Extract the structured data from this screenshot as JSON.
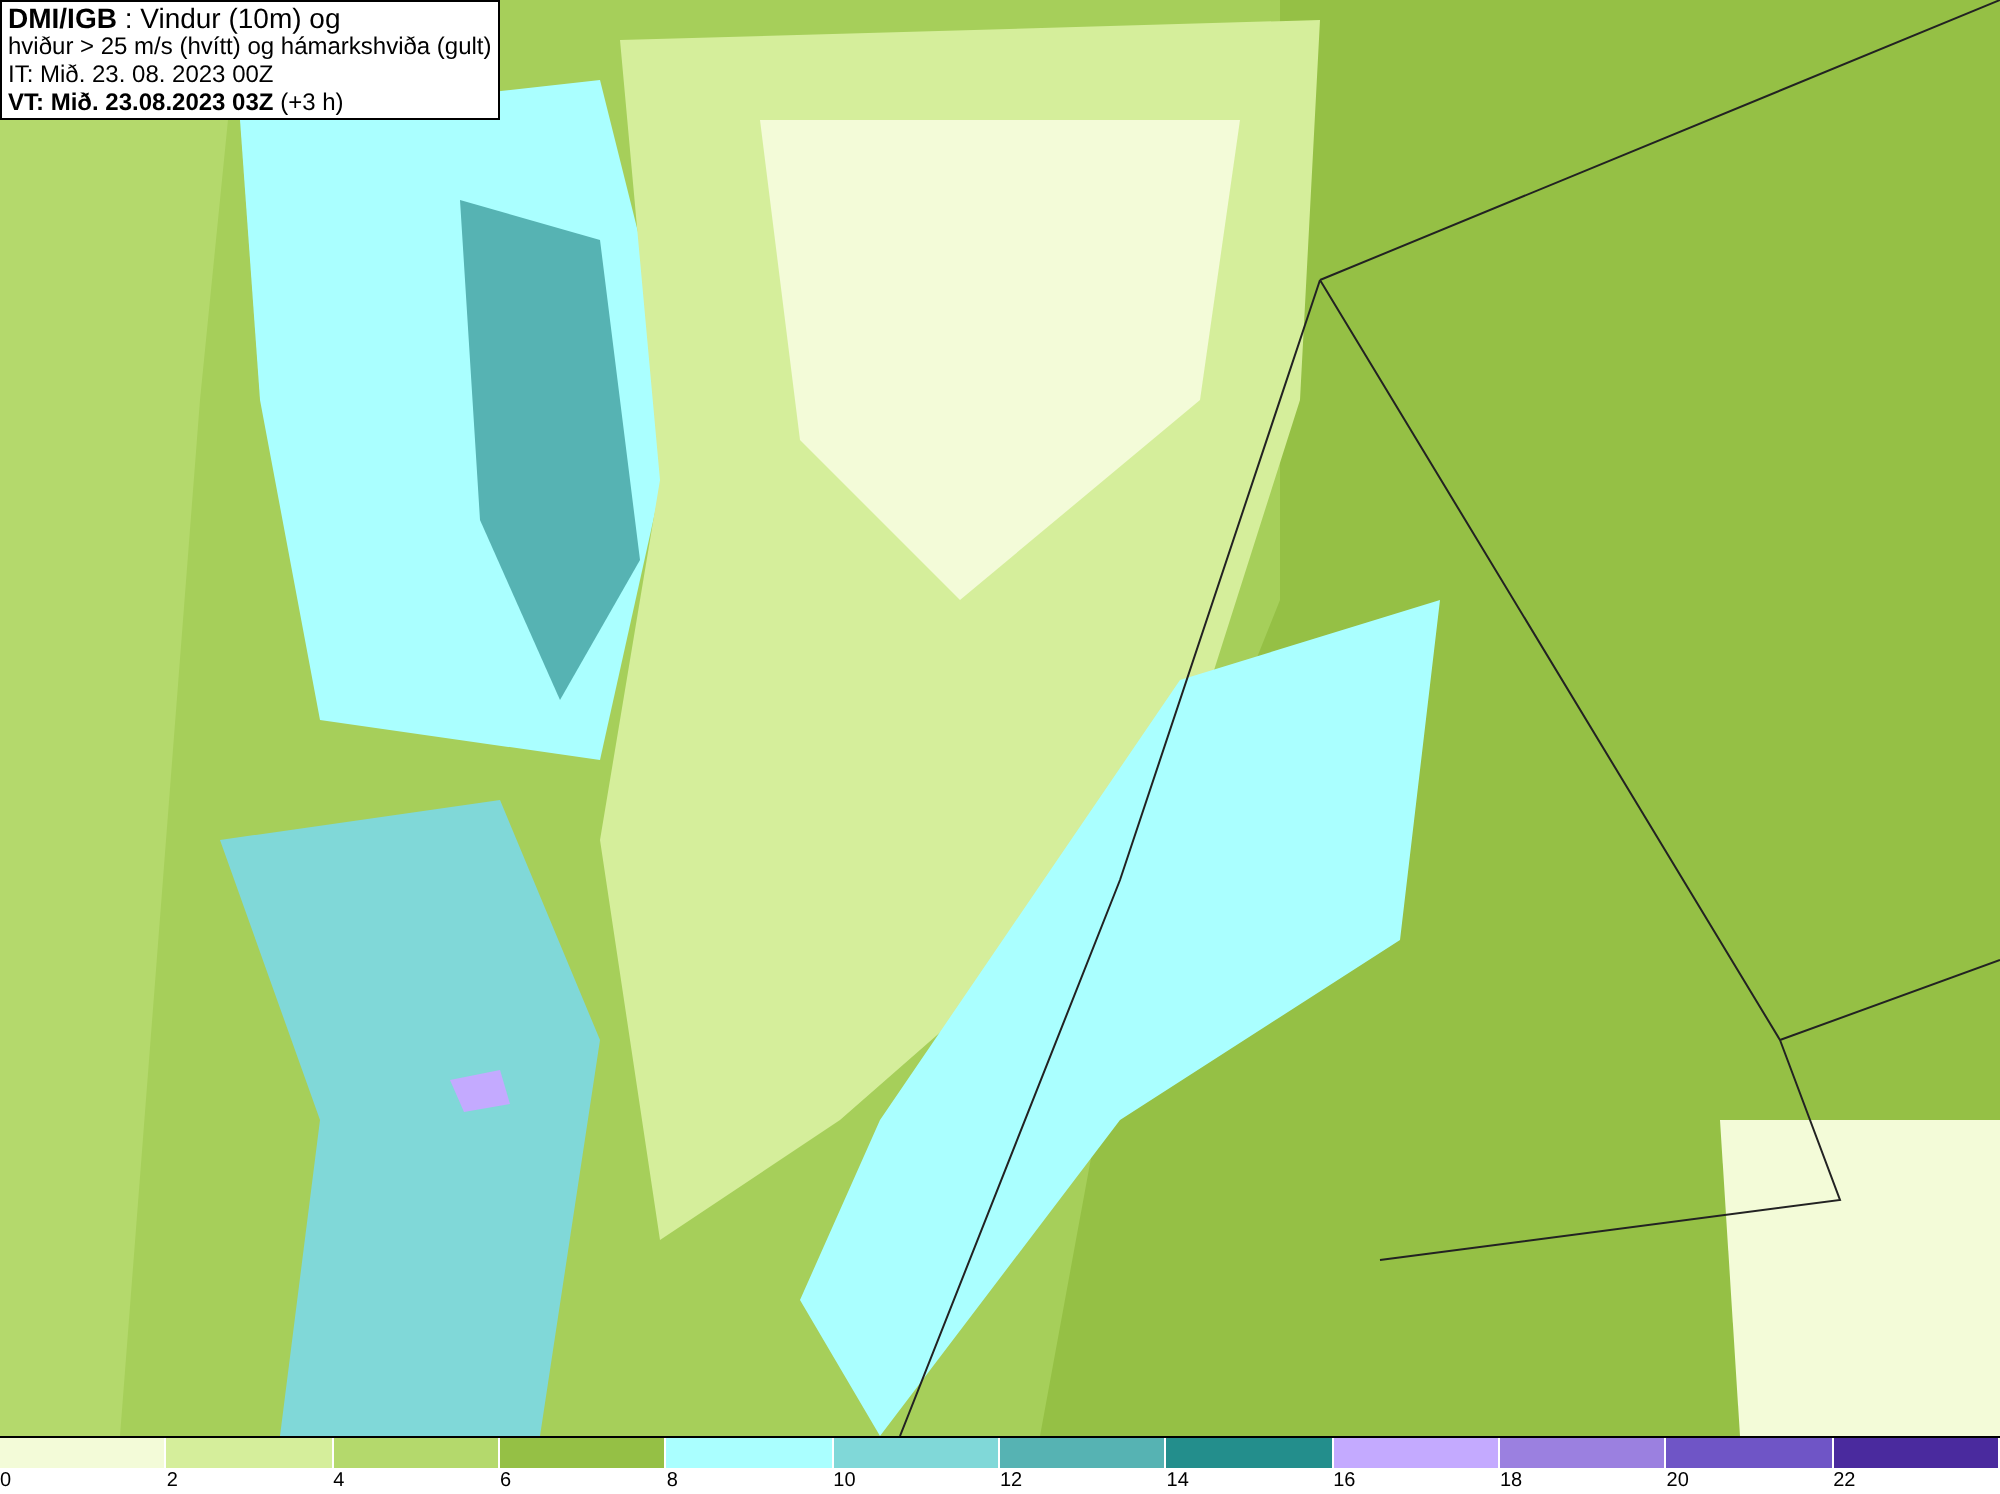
{
  "title_box": {
    "lines": [
      "**DMI/IGB** : Vindur (10m) og",
      "hviður > 25 m/s (hvítt) og hámarkshviða (gult)",
      "IT: Mið. 23. 08. 2023 00Z",
      "**VT: Mið. 23.08.2023 03Z** (+3 h)"
    ]
  },
  "legend": {
    "bins": [
      {
        "label": "0",
        "color": "#f3fbd8"
      },
      {
        "label": "2",
        "color": "#d5ee9b"
      },
      {
        "label": "4",
        "color": "#b4d96c"
      },
      {
        "label": "6",
        "color": "#95c045"
      },
      {
        "label": "8",
        "color": "#aaffff"
      },
      {
        "label": "10",
        "color": "#80d8d8"
      },
      {
        "label": "12",
        "color": "#56b3b3"
      },
      {
        "label": "14",
        "color": "#238e8c"
      },
      {
        "label": "16",
        "color": "#c4aaff"
      },
      {
        "label": "18",
        "color": "#9b80e0"
      },
      {
        "label": "20",
        "color": "#6f55c6"
      },
      {
        "label": "22",
        "color": "#4a2a9e"
      }
    ]
  }
}
